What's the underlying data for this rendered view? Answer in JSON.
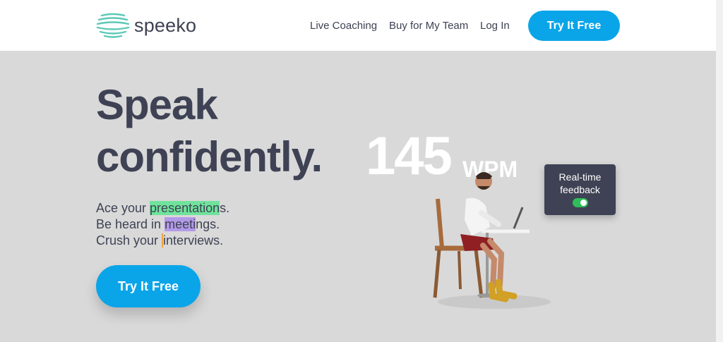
{
  "header": {
    "logo_text": "speeko",
    "nav": [
      {
        "label": "Live Coaching"
      },
      {
        "label": "Buy for My Team"
      },
      {
        "label": "Log In"
      }
    ],
    "cta_label": "Try It Free"
  },
  "hero": {
    "title_line1": "Speak",
    "title_line2": "confidently.",
    "lines": [
      {
        "before": "Ace your ",
        "highlight": "presentation",
        "after": "s."
      },
      {
        "before": "Be heard in ",
        "highlight": "meeti",
        "after": "ngs."
      },
      {
        "before": "Crush your ",
        "highlight": "i",
        "after": "nterviews."
      }
    ],
    "cta_label": "Try It Free"
  },
  "illustration": {
    "wpm_number": "145",
    "wpm_unit": "WPM",
    "feedback_line1": "Real-time",
    "feedback_line2": "feedback",
    "feedback_toggle_on": true
  },
  "colors": {
    "accent": "#0aa5e8",
    "text": "#3f4254",
    "logo": "#5cc9b7",
    "highlight_green": "#6fe39b",
    "highlight_purple": "#b39ae8",
    "highlight_orange": "#f2a33a",
    "toggle_on": "#2fbe5a"
  }
}
